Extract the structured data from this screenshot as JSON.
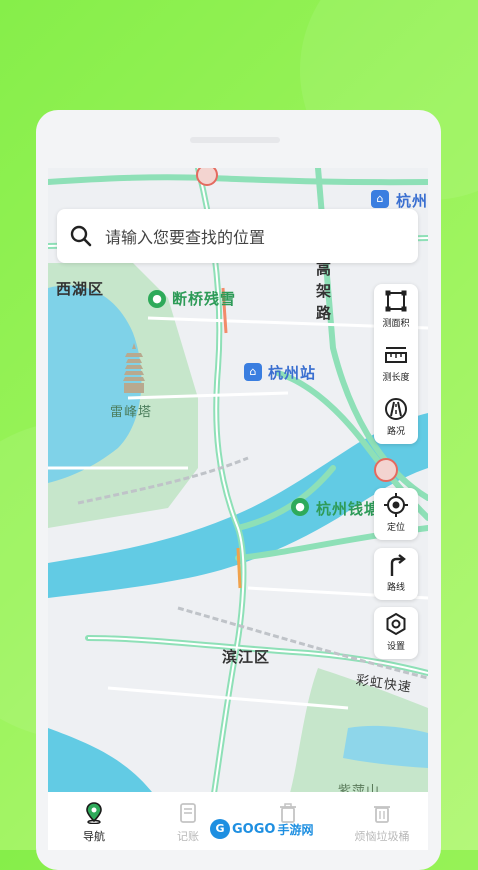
{
  "search": {
    "placeholder": "请输入您要查找的位置"
  },
  "map_labels": {
    "xihu": "西湖区",
    "duanqiao": "断桥残雪",
    "leifeng": "雷峰塔",
    "hangzhou_station": "杭州站",
    "gaojia": [
      "高",
      "架",
      "路"
    ],
    "hangzhou_top": "杭州",
    "qiantang": "杭州钱塘",
    "binjiang": "滨江区",
    "caihong": "彩虹快速",
    "bottom": "紫萍山"
  },
  "tools": [
    {
      "icon": "measure-area-icon",
      "label": "测面积"
    },
    {
      "icon": "measure-length-icon",
      "label": "测长度"
    },
    {
      "icon": "traffic-icon",
      "label": "路况"
    },
    {
      "icon": "locate-icon",
      "label": "定位"
    },
    {
      "icon": "route-icon",
      "label": "路线"
    },
    {
      "icon": "settings-icon",
      "label": "设置"
    }
  ],
  "tabs": [
    {
      "icon": "navigation-pin-icon",
      "label": "导航",
      "active": true
    },
    {
      "icon": "notebook-icon",
      "label": "记账",
      "active": false
    },
    {
      "icon": "trash-icon",
      "label": "",
      "active": false
    },
    {
      "icon": "trash-can-icon",
      "label": "烦恼垃圾桶",
      "active": false
    }
  ],
  "watermark": {
    "logo": "G",
    "brand": "GOGO",
    "suffix": "手游网"
  },
  "colors": {
    "accent": "#2eaa5a",
    "road": "#8ee0b7",
    "water": "#5bcbe6",
    "park": "#bde2c4"
  }
}
